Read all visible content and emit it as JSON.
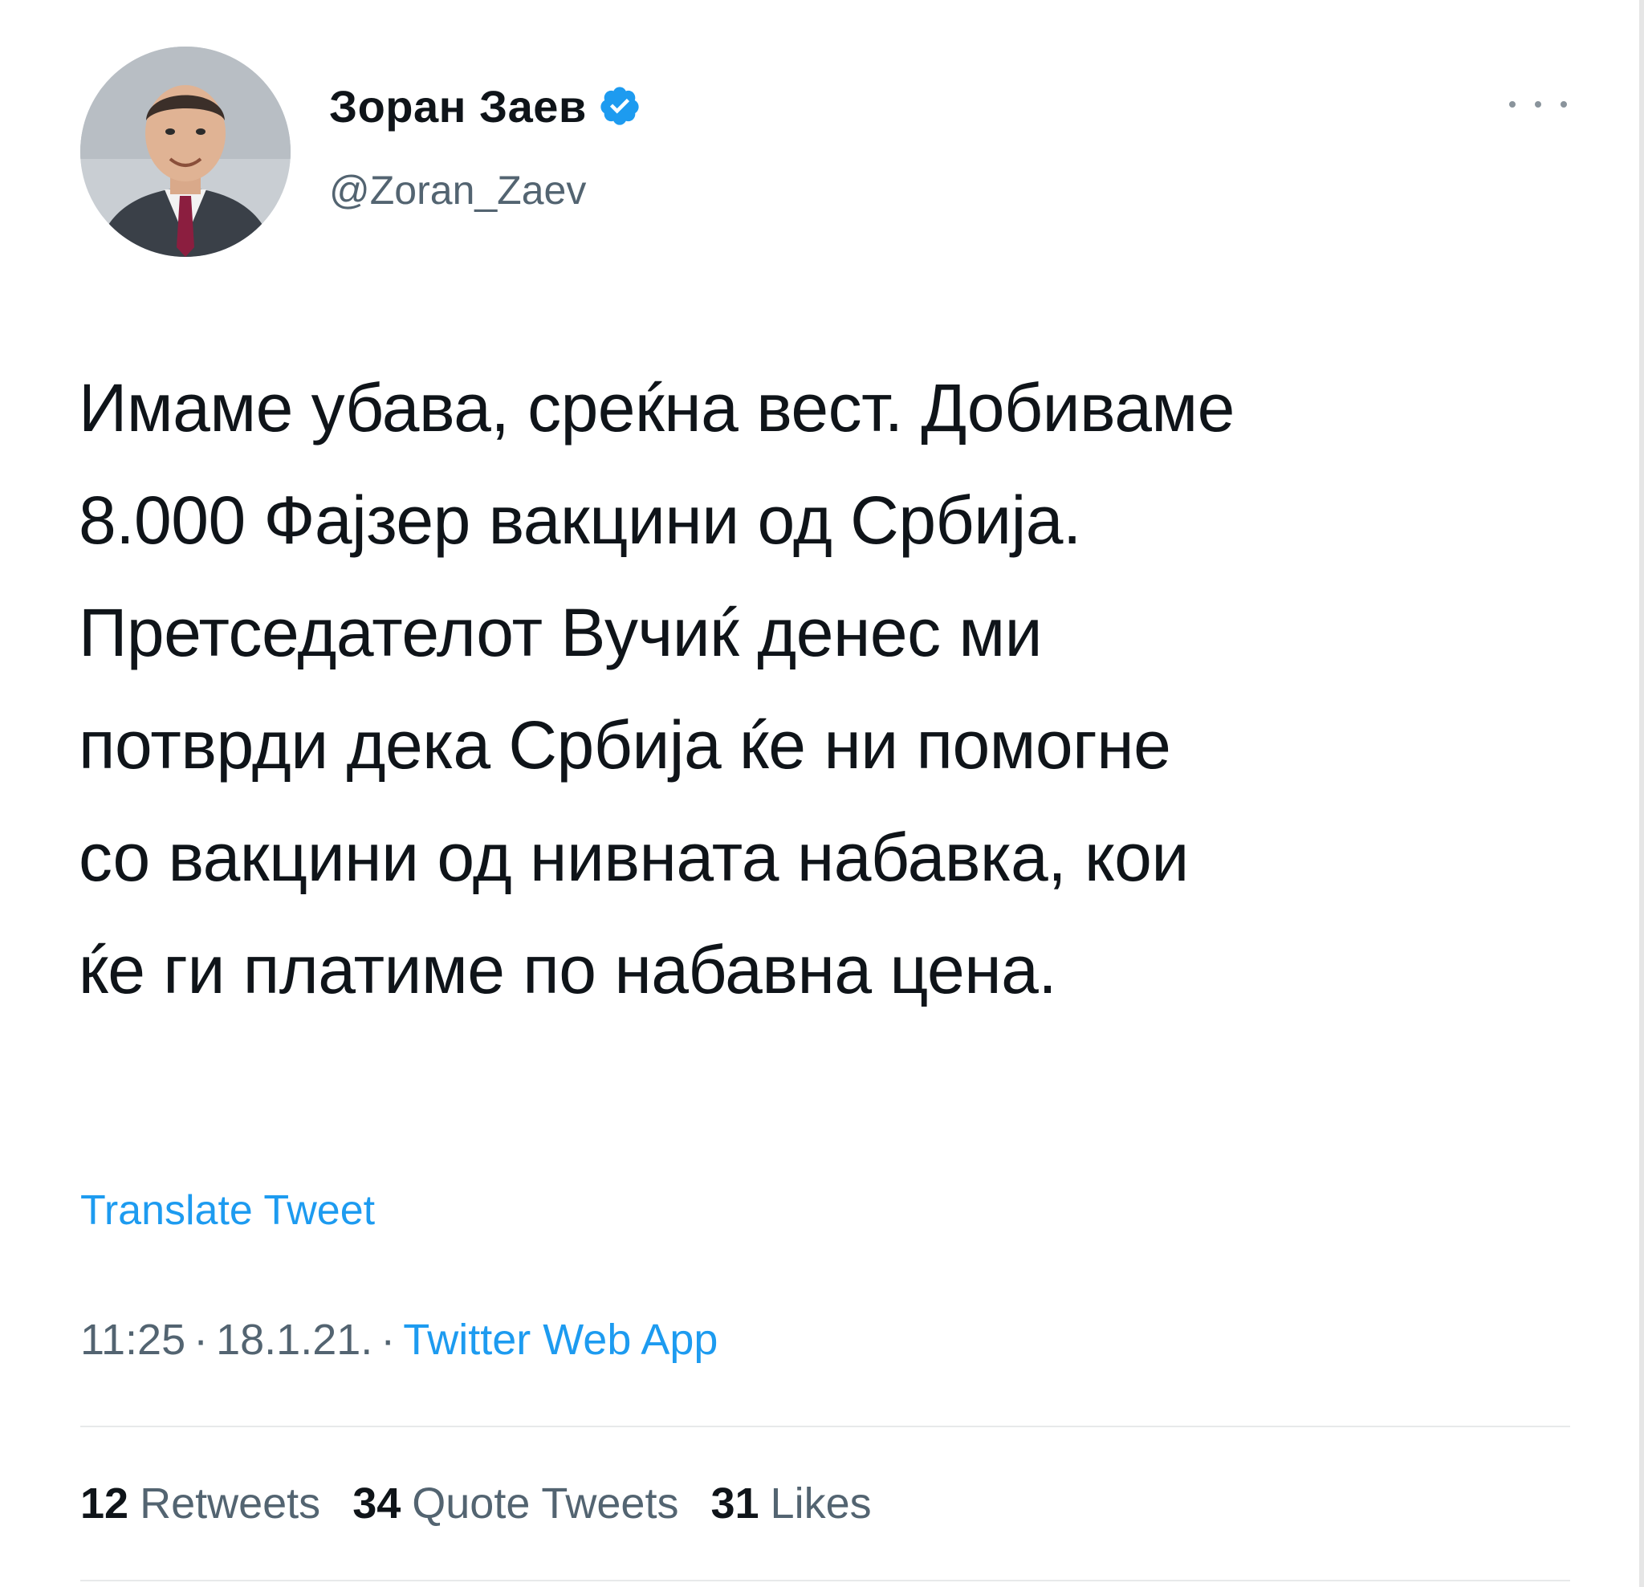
{
  "author": {
    "display_name": "Зоран Заев",
    "handle": "@Zoran_Zaev",
    "verified": true
  },
  "tweet": {
    "text": "Имаме убава, среќна вест. Добиваме\n8.000 Фајзер вакцини од Србија.\nПретседателот Вучиќ денес ми\nпотврди дека Србија ќе ни помогне\nсо вакцини од нивната набавка, кои\nќе ги платиме по набавна цена.",
    "translate_label": "Translate Tweet",
    "time": "11:25",
    "date": "18.1.21.",
    "separator": "·",
    "source": "Twitter Web App"
  },
  "stats": {
    "retweets_count": "12",
    "retweets_label": "Retweets",
    "quotes_count": "34",
    "quotes_label": "Quote Tweets",
    "likes_count": "31",
    "likes_label": "Likes"
  },
  "colors": {
    "link": "#1d9bf0",
    "secondary_text": "#536471",
    "primary_text": "#0f1419",
    "verified_badge": "#1d9bf0"
  },
  "icons": {
    "verified": "verified-badge-icon",
    "more": "more-options-icon"
  }
}
